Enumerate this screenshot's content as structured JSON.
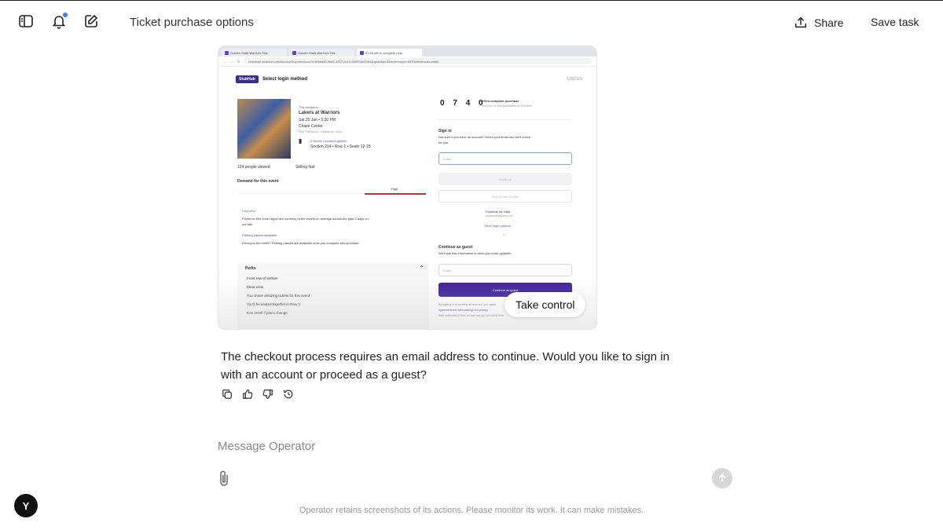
{
  "header": {
    "title": "Ticket purchase options",
    "share_label": "Share",
    "save_label": "Save task",
    "icons": [
      "sidebar-icon",
      "bell-icon",
      "edit-icon",
      "share-icon"
    ]
  },
  "screenshot": {
    "tabs": [
      "Golden State Warriors Tick",
      "Golden State Warriors Tick",
      "07:40 left to complete purc"
    ],
    "url": "checkout.stubhub.com/service/buy/checkout?ll=bf8ea60-0b60-4417-ac10-026f7d847ee4&quantity=2&inventoryid=8470&lexitmode-email",
    "logo": "StubHub",
    "select_login": "Select login method",
    "currency": "USD   EN",
    "event_tag": "This weekend",
    "event_title": "Lakers at Warriors",
    "event_date": "Sat 25 Jan • 5:30 PM",
    "venue": "Chase Center",
    "venue_loc": "San Francisco, California, USA",
    "ticket_note": "2 tickets • seated together",
    "seat": "Section 214 • Row 1 • Seats 12-15",
    "viewed": "124 people viewed",
    "selling_fast": "Selling fast",
    "demand_label": "Demand for this event",
    "demand_level": "High",
    "low_price": "Low price",
    "price_text_1": "Prices for this zone Upper are currently at the lowest on average across the past 3 days on",
    "price_text_2": "our site",
    "parking_link": "Parking passes available",
    "parking_text": "Driving to the event? Parking passes are available once you complete this purchase.",
    "perks_title": "Perks",
    "perks": [
      "Front row of section",
      "Clear view",
      "You chose amazing tickets for this event",
      "You'll be seated together in Row 1",
      "Can resell if plans change"
    ],
    "timer": "0 7 4 0",
    "timer_label": "left to complete purchase",
    "timer_sub": "Your price is only guaranteed for this time!",
    "sign_in": "Sign in",
    "sign_in_text_1": "Not sure if you have an account? Enter your email and we'll check",
    "sign_in_text_2": "for you.",
    "email_placeholder": "Email",
    "continue_btn": "Continue",
    "google_btn": "Sign in with Google",
    "continue_as": "Continue as Yash",
    "continue_as_email": "yashsingh@gmail.com",
    "other_options": "Other login options",
    "or": "or",
    "guest_title": "Continue as guest",
    "guest_text": "We'll use this information to send you order updates.",
    "guest_email": "Email",
    "guest_btn": "Continue as guest",
    "legal_1": "By signing in or creating an account, you agree",
    "legal_2": "agreement and acknowledge our privacy",
    "legal_3": "SMS notifications from us and can opt out at any time"
  },
  "take_control": "Take control",
  "message": "The checkout process requires an email address to continue. Would you like to sign in with an account or proceed as a guest?",
  "composer": {
    "placeholder": "Message Operator"
  },
  "footer": "Operator retains screenshots of its actions. Please monitor its work. It can make mistakes.",
  "avatar_letter": "Y",
  "colors": {
    "accent_dot": "#3b82f6",
    "stubhub_purple": "#3d1f99",
    "demand_red": "#c62f3a"
  }
}
